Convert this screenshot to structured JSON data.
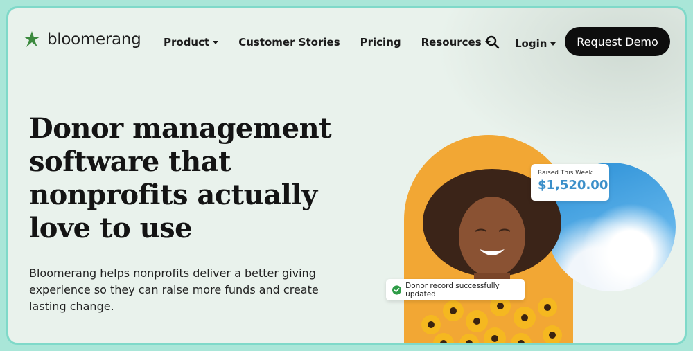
{
  "brand": {
    "name": "bloomerang",
    "accent": "#3b8a3e"
  },
  "nav": {
    "items": [
      {
        "label": "Product",
        "has_dropdown": true
      },
      {
        "label": "Customer Stories",
        "has_dropdown": false
      },
      {
        "label": "Pricing",
        "has_dropdown": false
      },
      {
        "label": "Resources",
        "has_dropdown": true
      }
    ],
    "search_icon": "search-icon",
    "login_label": "Login",
    "cta_label": "Request Demo"
  },
  "hero": {
    "headline": "Donor management software that nonprofits actually love to use",
    "subtext": "Bloomerang helps nonprofits deliver a better giving experience so they can raise more funds and create lasting change."
  },
  "cards": {
    "raised_label": "Raised This Week",
    "raised_amount": "$1,520.00",
    "toast_message": "Donor record successfully updated"
  },
  "colors": {
    "background": "#e9f2ec",
    "border": "#7fd9c9",
    "cta_bg": "#0d0d0d",
    "arch": "#f2a734",
    "amount": "#3b8fc9",
    "success": "#2e9c47"
  }
}
